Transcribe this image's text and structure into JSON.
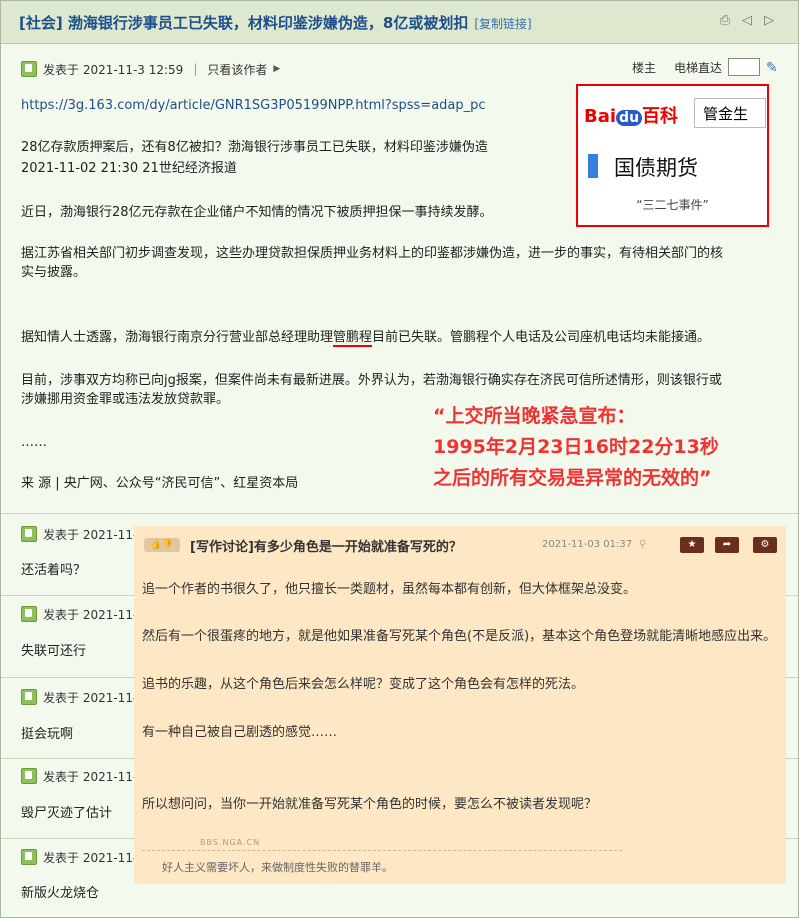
{
  "thread": {
    "title": "[社会] 渤海银行涉事员工已失联，材料印鉴涉嫌伪造，8亿或被划扣",
    "copy_link": "[复制链接]",
    "main_post": {
      "posted": "发表于 2021-11-3 12:59",
      "only_author": "只看该作者",
      "floor_label": "楼主",
      "elevator_label": "电梯直达",
      "link": "https://3g.163.com/dy/article/GNR1SG3P05199NPP.html?spss=adap_pc",
      "lines": [
        "28亿存款质押案后，还有8亿被扣？渤海银行涉事员工已失联，材料印鉴涉嫌伪造",
        "2021-11-02 21:30 21世纪经济报道",
        "近日，渤海银行28亿元存款在企业储户不知情的情况下被质押担保一事持续发酵。",
        "据江苏省相关部门初步调查发现，这些办理贷款担保质押业务材料上的印鉴都涉嫌伪造，进一步的事实，有待相关部门的核",
        "实与披露。",
        "据知情人士透露，渤海银行南京分行营业部总经理助理",
        "管鹏程",
        "目前已失联。管鹏程个人电话及公司座机电话均未能接通。",
        "目前，涉事双方均称已向jg报案，但案件尚未有最新进展。外界认为，若渤海银行确实存在济民可信所述情形，则该银行或",
        "涉嫌挪用资金罪或违法发放贷款罪。",
        "……",
        "来 源 | 央广网、公众号“济民可信”、红星资本局"
      ]
    },
    "replies": [
      {
        "posted": "发表于 2021-11-3",
        "text": "还活着吗？"
      },
      {
        "posted": "发表于 2021-11-3",
        "text": "失联可还行"
      },
      {
        "posted": "发表于 2021-11-3",
        "text": "挺会玩啊"
      },
      {
        "posted": "发表于 2021-11-3",
        "text": "毁尸灭迹了估计"
      },
      {
        "posted": "发表于 2021-11-3",
        "text": "新版火龙烧仓"
      }
    ]
  },
  "baidu": {
    "logo_bai": "Bai",
    "logo_du": "du",
    "logo_baike": "百科",
    "search_text": "管金生",
    "entry_title": "国债期货",
    "entry_sub": "“三二七事件”"
  },
  "red_quote": {
    "line1": "“上交所当晚紧急宣布：",
    "line2": "1995年2月23日16时22分13秒",
    "line3": "之后的所有交易是异常的无效的”"
  },
  "overlay_post": {
    "title": "[写作讨论]有多少角色是一开始就准备写死的？",
    "date": "2021-11-03 01:37",
    "paragraphs": [
      "追一个作者的书很久了，他只擅长一类题材，虽然每本都有创新，但大体框架总没变。",
      "然后有一个很蛋疼的地方，就是他如果准备写死某个角色(不是反派)，基本这个角色登场就能清晰地感应出来。",
      "追书的乐趣，从这个角色后来会怎么样呢？变成了这个角色会有怎样的死法。",
      "有一种自己被自己剧透的感觉……",
      "所以想问问，当你一开始就准备写死某个角色的时候，要怎么不被读者发现呢？"
    ],
    "watermark": "BBS.NGA.CN",
    "signature": "好人主义需要坏人，来做制度性失败的替罪羊。"
  }
}
